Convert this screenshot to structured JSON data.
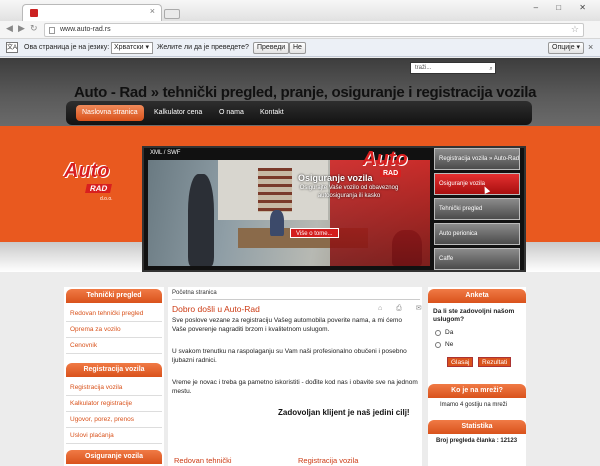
{
  "browser": {
    "url": "www.auto-rad.rs",
    "window_controls": "– □ ✕"
  },
  "translate_bar": {
    "prefix": "Ова страница је на језику:",
    "language": "Хрватски",
    "question": "Желите ли да је преведете?",
    "translate_btn": "Преведи",
    "no_btn": "Не",
    "options_btn": "Опције"
  },
  "header": {
    "search_placeholder": "traži...",
    "title": "Auto - Rad » tehnički pregled, pranje, osiguranje i registracija vozila",
    "nav": [
      "Naslovna stranica",
      "Kalkulator cena",
      "O nama",
      "Kontakt"
    ]
  },
  "logo": {
    "auto": "Auto",
    "rad": "RAD",
    "doo": "d.o.o."
  },
  "slider": {
    "xml_label": "XML / SWF",
    "title": "Osiguranje vozila",
    "text": "Osigurajte Vaše vozilo od obaveznog autoosiguranja ili kasko",
    "more": "Više o tome...",
    "thumbs": [
      "Registracija vozila » Auto-Rad",
      "Osiguranje vozila",
      "Tehnički pregled",
      "Auto perionica",
      "Caffe"
    ]
  },
  "left_sidebar": {
    "box1_title": "Tehnički pregled",
    "box1_items": [
      "Redovan tehnički pregled",
      "Oprema za vozilo",
      "Cenovnik"
    ],
    "box2_title": "Registracija vozila",
    "box2_items": [
      "Registracija vozila",
      "Kalkulator registracije",
      "Ugovor, porez, prenos",
      "Uslovi plaćanja"
    ],
    "box3_title": "Osiguranje vozila"
  },
  "main": {
    "breadcrumb": "Početna stranica",
    "article_title": "Dobro došli u Auto-Rad",
    "article_icons": "⌂ ⎙ ✉",
    "p1": "Sve poslove vezane za registraciju Vašeg automobila poverite nama, a mi ćemo Vaše poverenje nagraditi brzom i kvalitetnom uslugom.",
    "p2": "U svakom trenutku na raspolaganju su Vam naši profesionalno obučeni i posebno ljubazni radnici.",
    "p3": "Vreme je novac i treba ga pametno iskoristiti - dođite kod nas i obavite sve na jednom mestu.",
    "motto": "Zadovoljan klijent je naš jedini cilj!",
    "sub1": "Redovan tehnički",
    "sub2": "Registracija vozila"
  },
  "right_sidebar": {
    "poll_title": "Anketa",
    "poll_question": "Da li ste zadovoljni našom uslugom?",
    "options": [
      "Da",
      "Ne"
    ],
    "vote_btn": "Glasaj",
    "results_btn": "Rezultati",
    "online_title": "Ko je na mreži?",
    "online_text": "Imamo 4 gostiju na mreži",
    "stats_title": "Statistika",
    "stats_text": "Broj pregleda članka : 12123"
  }
}
